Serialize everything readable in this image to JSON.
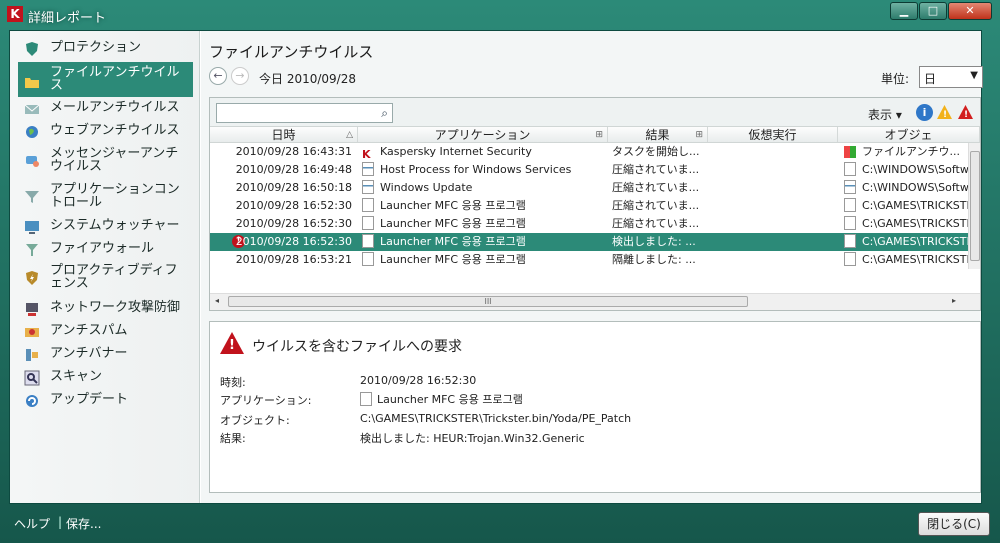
{
  "window": {
    "title": "詳細レポート",
    "logo": "K",
    "controls": {
      "minimize": "▁",
      "maximize": "□",
      "close": "✕"
    }
  },
  "sidebar": {
    "items": [
      {
        "label": "プロテクション",
        "icon": "shield-icon"
      },
      {
        "label": "ファイルアンチウイルス",
        "icon": "folder-icon",
        "selected": true
      },
      {
        "label": "メールアンチウイルス",
        "icon": "mail-icon"
      },
      {
        "label": "ウェブアンチウイルス",
        "icon": "globe-icon"
      },
      {
        "label": "メッセンジャーアンチウイルス",
        "icon": "messenger-icon"
      },
      {
        "label": "アプリケーションコントロール",
        "icon": "funnel-icon"
      },
      {
        "label": "システムウォッチャー",
        "icon": "monitor-icon"
      },
      {
        "label": "ファイアウォール",
        "icon": "firewall-icon"
      },
      {
        "label": "プロアクティブディフェンス",
        "icon": "proactive-shield-icon"
      },
      {
        "label": "ネットワーク攻撃防御",
        "icon": "network-icon"
      },
      {
        "label": "アンチスパム",
        "icon": "antispam-icon"
      },
      {
        "label": "アンチバナー",
        "icon": "antibanner-icon"
      },
      {
        "label": "スキャン",
        "icon": "scan-icon"
      },
      {
        "label": "アップデート",
        "icon": "update-icon"
      }
    ]
  },
  "main": {
    "title": "ファイルアンチウイルス",
    "date_label": "今日 2010/09/28",
    "unit_label": "単位:",
    "unit_value": "日",
    "view_label": "表示 ▾",
    "nav": {
      "back": "←",
      "forward": "→"
    }
  },
  "grid": {
    "headers": [
      "日時",
      "アプリケーション",
      "結果",
      "仮想実行",
      "オブジェ"
    ],
    "sort_mark": "△",
    "expand_mark": "⊞",
    "rows": [
      {
        "date": "2010/09/28 16:43:31",
        "app": "Kaspersky Internet Security",
        "result": "タスクを開始し...",
        "object": "ファイルアンチウ..."
      },
      {
        "date": "2010/09/28 16:49:48",
        "app": "Host Process for Windows Services",
        "result": "圧縮されていま...",
        "object": "C:\\WINDOWS\\Softw"
      },
      {
        "date": "2010/09/28 16:50:18",
        "app": "Windows Update",
        "result": "圧縮されていま...",
        "object": "C:\\WINDOWS\\Softw"
      },
      {
        "date": "2010/09/28 16:52:30",
        "app": "Launcher MFC 응용 프로그램",
        "result": "圧縮されていま...",
        "object": "C:\\GAMES\\TRICKSTE"
      },
      {
        "date": "2010/09/28 16:52:30",
        "app": "Launcher MFC 응용 프로그램",
        "result": "圧縮されていま...",
        "object": "C:\\GAMES\\TRICKSTE"
      },
      {
        "date": "2010/09/28 16:52:30",
        "app": "Launcher MFC 응용 프로그램",
        "result": "検出しました: ...",
        "object": "C:\\GAMES\\TRICKSTE",
        "selected": true
      },
      {
        "date": "2010/09/28 16:53:21",
        "app": "Launcher MFC 응용 프로그램",
        "result": "隔離しました: ...",
        "object": "C:\\GAMES\\TRICKSTE"
      }
    ],
    "scroll": {
      "left": "◂",
      "right": "▸",
      "grip": "III"
    }
  },
  "detail": {
    "title": "ウイルスを含むファイルへの要求",
    "time_label": "時刻:",
    "time_value": "2010/09/28 16:52:30",
    "app_label": "アプリケーション:",
    "app_value": "Launcher MFC 응용 프로그램",
    "object_label": "オブジェクト:",
    "object_value": "C:\\GAMES\\TRICKSTER\\Trickster.bin/Yoda/PE_Patch",
    "result_label": "結果:",
    "result_value": "検出しました: HEUR:Trojan.Win32.Generic"
  },
  "footer": {
    "help": "ヘルプ",
    "separator": "|",
    "save": "保存...",
    "close": "閉じる(C)"
  }
}
